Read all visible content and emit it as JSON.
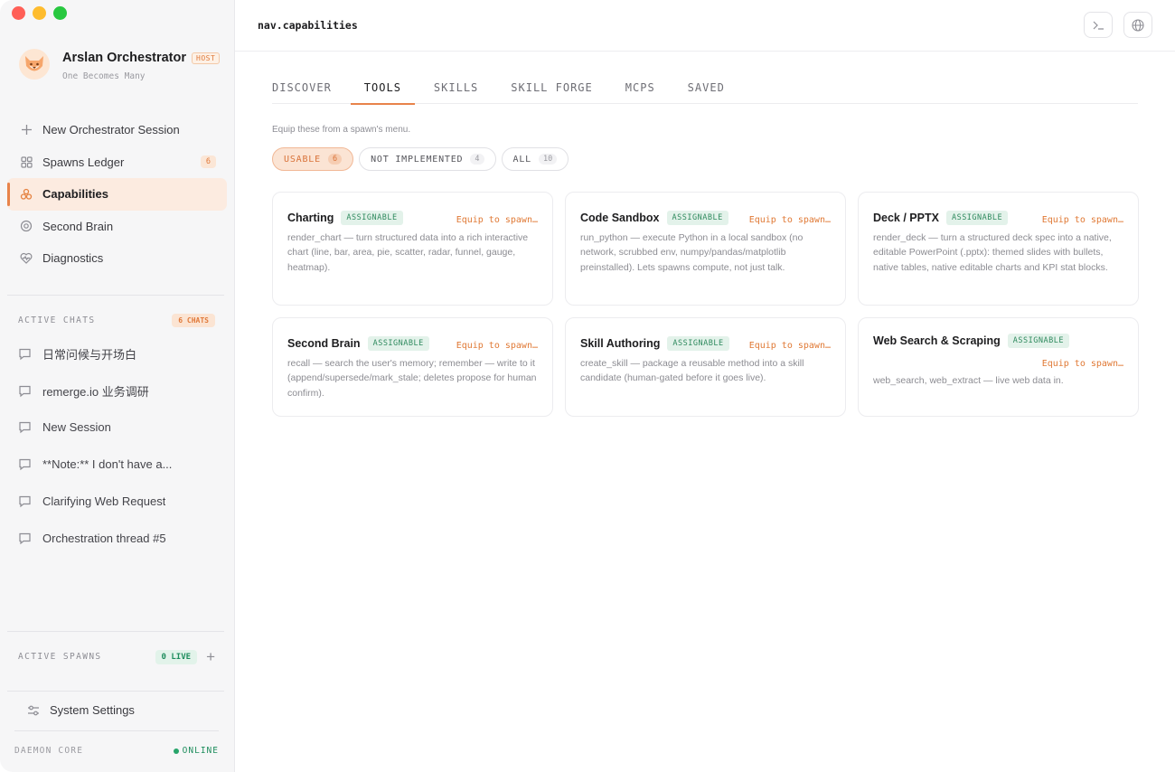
{
  "app": {
    "name": "Arslan Orchestrator",
    "badge": "HOST",
    "tagline": "One Becomes Many"
  },
  "nav": {
    "items": [
      {
        "label": "New Orchestrator Session",
        "icon": "plus-icon"
      },
      {
        "label": "Spawns Ledger",
        "icon": "grid-icon",
        "count": "6"
      },
      {
        "label": "Capabilities",
        "icon": "hexagons-icon",
        "active": true
      },
      {
        "label": "Second Brain",
        "icon": "brain-icon"
      },
      {
        "label": "Diagnostics",
        "icon": "heart-pulse-icon"
      }
    ]
  },
  "active_chats": {
    "title": "ACTIVE CHATS",
    "badge": "6 CHATS",
    "items": [
      {
        "label": "日常问候与开场白"
      },
      {
        "label": "remerge.io 业务调研"
      },
      {
        "label": "New Session"
      },
      {
        "label": "**Note:** I don't have a..."
      },
      {
        "label": "Clarifying Web Request"
      },
      {
        "label": "Orchestration thread #5"
      }
    ]
  },
  "active_spawns": {
    "title": "ACTIVE SPAWNS",
    "badge": "0 LIVE"
  },
  "footer": {
    "settings_label": "System Settings",
    "daemon_label": "DAEMON CORE",
    "daemon_status": "ONLINE"
  },
  "topbar": {
    "route": "nav.capabilities"
  },
  "tabs": [
    {
      "label": "DISCOVER"
    },
    {
      "label": "TOOLS",
      "active": true
    },
    {
      "label": "SKILLS"
    },
    {
      "label": "SKILL FORGE"
    },
    {
      "label": "MCPS"
    },
    {
      "label": "SAVED"
    }
  ],
  "hint": "Equip these from a spawn's menu.",
  "filters": [
    {
      "label": "USABLE",
      "count": "6",
      "active": true
    },
    {
      "label": "NOT IMPLEMENTED",
      "count": "4"
    },
    {
      "label": "ALL",
      "count": "10"
    }
  ],
  "tools": [
    {
      "title": "Charting",
      "badge": "ASSIGNABLE",
      "action": "Equip to spawn…",
      "desc": "render_chart — turn structured data into a rich interactive chart (line, bar, area, pie, scatter, radar, funnel, gauge, heatmap)."
    },
    {
      "title": "Code Sandbox",
      "badge": "ASSIGNABLE",
      "action": "Equip to spawn…",
      "desc": "run_python — execute Python in a local sandbox (no network, scrubbed env, numpy/pandas/matplotlib preinstalled). Lets spawns compute, not just talk."
    },
    {
      "title": "Deck / PPTX",
      "badge": "ASSIGNABLE",
      "action": "Equip to spawn…",
      "desc": "render_deck — turn a structured deck spec into a native, editable PowerPoint (.pptx): themed slides with bullets, native tables, native editable charts and KPI stat blocks."
    },
    {
      "title": "Second Brain",
      "badge": "ASSIGNABLE",
      "action": "Equip to spawn…",
      "desc": "recall — search the user's memory; remember — write to it (append/supersede/mark_stale; deletes propose for human confirm)."
    },
    {
      "title": "Skill Authoring",
      "badge": "ASSIGNABLE",
      "action": "Equip to spawn…",
      "desc": "create_skill — package a reusable method into a skill candidate (human-gated before it goes live)."
    },
    {
      "title": "Web Search & Scraping",
      "badge": "ASSIGNABLE",
      "action": "Equip to spawn…",
      "desc": "web_search, web_extract — live web data in."
    }
  ]
}
